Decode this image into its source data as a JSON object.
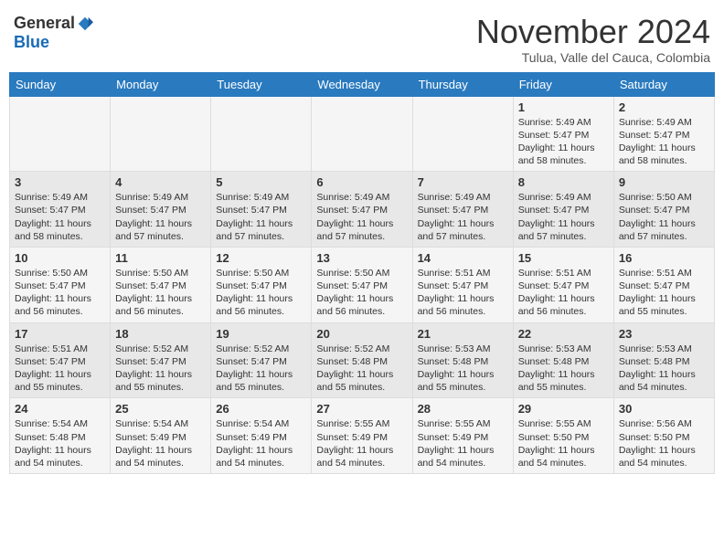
{
  "header": {
    "logo": {
      "general": "General",
      "blue": "Blue"
    },
    "title": "November 2024",
    "location": "Tulua, Valle del Cauca, Colombia"
  },
  "calendar": {
    "days_of_week": [
      "Sunday",
      "Monday",
      "Tuesday",
      "Wednesday",
      "Thursday",
      "Friday",
      "Saturday"
    ],
    "weeks": [
      [
        {
          "day": "",
          "info": ""
        },
        {
          "day": "",
          "info": ""
        },
        {
          "day": "",
          "info": ""
        },
        {
          "day": "",
          "info": ""
        },
        {
          "day": "",
          "info": ""
        },
        {
          "day": "1",
          "info": "Sunrise: 5:49 AM\nSunset: 5:47 PM\nDaylight: 11 hours and 58 minutes."
        },
        {
          "day": "2",
          "info": "Sunrise: 5:49 AM\nSunset: 5:47 PM\nDaylight: 11 hours and 58 minutes."
        }
      ],
      [
        {
          "day": "3",
          "info": "Sunrise: 5:49 AM\nSunset: 5:47 PM\nDaylight: 11 hours and 58 minutes."
        },
        {
          "day": "4",
          "info": "Sunrise: 5:49 AM\nSunset: 5:47 PM\nDaylight: 11 hours and 57 minutes."
        },
        {
          "day": "5",
          "info": "Sunrise: 5:49 AM\nSunset: 5:47 PM\nDaylight: 11 hours and 57 minutes."
        },
        {
          "day": "6",
          "info": "Sunrise: 5:49 AM\nSunset: 5:47 PM\nDaylight: 11 hours and 57 minutes."
        },
        {
          "day": "7",
          "info": "Sunrise: 5:49 AM\nSunset: 5:47 PM\nDaylight: 11 hours and 57 minutes."
        },
        {
          "day": "8",
          "info": "Sunrise: 5:49 AM\nSunset: 5:47 PM\nDaylight: 11 hours and 57 minutes."
        },
        {
          "day": "9",
          "info": "Sunrise: 5:50 AM\nSunset: 5:47 PM\nDaylight: 11 hours and 57 minutes."
        }
      ],
      [
        {
          "day": "10",
          "info": "Sunrise: 5:50 AM\nSunset: 5:47 PM\nDaylight: 11 hours and 56 minutes."
        },
        {
          "day": "11",
          "info": "Sunrise: 5:50 AM\nSunset: 5:47 PM\nDaylight: 11 hours and 56 minutes."
        },
        {
          "day": "12",
          "info": "Sunrise: 5:50 AM\nSunset: 5:47 PM\nDaylight: 11 hours and 56 minutes."
        },
        {
          "day": "13",
          "info": "Sunrise: 5:50 AM\nSunset: 5:47 PM\nDaylight: 11 hours and 56 minutes."
        },
        {
          "day": "14",
          "info": "Sunrise: 5:51 AM\nSunset: 5:47 PM\nDaylight: 11 hours and 56 minutes."
        },
        {
          "day": "15",
          "info": "Sunrise: 5:51 AM\nSunset: 5:47 PM\nDaylight: 11 hours and 56 minutes."
        },
        {
          "day": "16",
          "info": "Sunrise: 5:51 AM\nSunset: 5:47 PM\nDaylight: 11 hours and 55 minutes."
        }
      ],
      [
        {
          "day": "17",
          "info": "Sunrise: 5:51 AM\nSunset: 5:47 PM\nDaylight: 11 hours and 55 minutes."
        },
        {
          "day": "18",
          "info": "Sunrise: 5:52 AM\nSunset: 5:47 PM\nDaylight: 11 hours and 55 minutes."
        },
        {
          "day": "19",
          "info": "Sunrise: 5:52 AM\nSunset: 5:47 PM\nDaylight: 11 hours and 55 minutes."
        },
        {
          "day": "20",
          "info": "Sunrise: 5:52 AM\nSunset: 5:48 PM\nDaylight: 11 hours and 55 minutes."
        },
        {
          "day": "21",
          "info": "Sunrise: 5:53 AM\nSunset: 5:48 PM\nDaylight: 11 hours and 55 minutes."
        },
        {
          "day": "22",
          "info": "Sunrise: 5:53 AM\nSunset: 5:48 PM\nDaylight: 11 hours and 55 minutes."
        },
        {
          "day": "23",
          "info": "Sunrise: 5:53 AM\nSunset: 5:48 PM\nDaylight: 11 hours and 54 minutes."
        }
      ],
      [
        {
          "day": "24",
          "info": "Sunrise: 5:54 AM\nSunset: 5:48 PM\nDaylight: 11 hours and 54 minutes."
        },
        {
          "day": "25",
          "info": "Sunrise: 5:54 AM\nSunset: 5:49 PM\nDaylight: 11 hours and 54 minutes."
        },
        {
          "day": "26",
          "info": "Sunrise: 5:54 AM\nSunset: 5:49 PM\nDaylight: 11 hours and 54 minutes."
        },
        {
          "day": "27",
          "info": "Sunrise: 5:55 AM\nSunset: 5:49 PM\nDaylight: 11 hours and 54 minutes."
        },
        {
          "day": "28",
          "info": "Sunrise: 5:55 AM\nSunset: 5:49 PM\nDaylight: 11 hours and 54 minutes."
        },
        {
          "day": "29",
          "info": "Sunrise: 5:55 AM\nSunset: 5:50 PM\nDaylight: 11 hours and 54 minutes."
        },
        {
          "day": "30",
          "info": "Sunrise: 5:56 AM\nSunset: 5:50 PM\nDaylight: 11 hours and 54 minutes."
        }
      ]
    ]
  }
}
